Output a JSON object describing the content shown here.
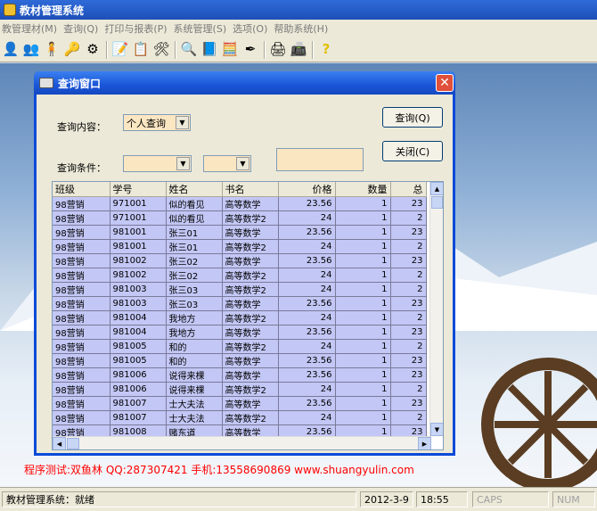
{
  "app": {
    "title": "教材管理系统"
  },
  "menu": {
    "items": [
      "教管理材(M)",
      "查询(Q)",
      "打印与报表(P)",
      "系统管理(S)",
      "选项(O)",
      "帮助系统(H)"
    ]
  },
  "toolbar": {
    "icons": [
      "person-icon",
      "people-icon",
      "user-check-icon",
      "key-icon",
      "gear-people-icon",
      "edit-icon",
      "form-icon",
      "tools-icon",
      "search-icon",
      "book-icon",
      "calculator-icon",
      "pen-icon",
      "print-icon",
      "print-preview-icon",
      "help-icon"
    ]
  },
  "dialog": {
    "title": "查询窗口",
    "close_label": "✕",
    "query_content_label": "查询内容：",
    "query_content_value": "个人查询",
    "query_condition_label": "查询条件：",
    "condition1_value": "",
    "condition2_value": "",
    "search_button": "查询(Q)",
    "close_button": "关闭(C)"
  },
  "grid": {
    "columns": [
      "班级",
      "学号",
      "姓名",
      "书名",
      "价格",
      "数量",
      "总"
    ],
    "rows": [
      [
        "98营销",
        "971001",
        "似的看见",
        "高等数学",
        "23.56",
        "1",
        "23"
      ],
      [
        "98营销",
        "971001",
        "似的看见",
        "高等数学2",
        "24",
        "1",
        "2"
      ],
      [
        "98营销",
        "981001",
        "张三01",
        "高等数学",
        "23.56",
        "1",
        "23"
      ],
      [
        "98营销",
        "981001",
        "张三01",
        "高等数学2",
        "24",
        "1",
        "2"
      ],
      [
        "98营销",
        "981002",
        "张三02",
        "高等数学",
        "23.56",
        "1",
        "23"
      ],
      [
        "98营销",
        "981002",
        "张三02",
        "高等数学2",
        "24",
        "1",
        "2"
      ],
      [
        "98营销",
        "981003",
        "张三03",
        "高等数学2",
        "24",
        "1",
        "2"
      ],
      [
        "98营销",
        "981003",
        "张三03",
        "高等数学",
        "23.56",
        "1",
        "23"
      ],
      [
        "98营销",
        "981004",
        "我地方",
        "高等数学2",
        "24",
        "1",
        "2"
      ],
      [
        "98营销",
        "981004",
        "我地方",
        "高等数学",
        "23.56",
        "1",
        "23"
      ],
      [
        "98营销",
        "981005",
        "和的",
        "高等数学2",
        "24",
        "1",
        "2"
      ],
      [
        "98营销",
        "981005",
        "和的",
        "高等数学",
        "23.56",
        "1",
        "23"
      ],
      [
        "98营销",
        "981006",
        "说得来棵",
        "高等数学",
        "23.56",
        "1",
        "23"
      ],
      [
        "98营销",
        "981006",
        "说得来棵",
        "高等数学2",
        "24",
        "1",
        "2"
      ],
      [
        "98营销",
        "981007",
        "士大夫法",
        "高等数学",
        "23.56",
        "1",
        "23"
      ],
      [
        "98营销",
        "981007",
        "士大夫法",
        "高等数学2",
        "24",
        "1",
        "2"
      ],
      [
        "98营销",
        "981008",
        "赌东道",
        "高等数学",
        "23.56",
        "1",
        "23"
      ]
    ]
  },
  "credits": "程序测试:双鱼林 QQ:287307421 手机:13558690869 www.shuangyulin.com",
  "statusbar": {
    "main": "教材管理系统：就绪",
    "date": "2012-3-9",
    "time": "18:55",
    "caps": "CAPS",
    "num": "NUM"
  },
  "colors": {
    "row_bg": "#c3c7f5",
    "input_bg": "#fbe6c2",
    "title_bar": "#1a55d8",
    "credits": "#ff0000"
  }
}
